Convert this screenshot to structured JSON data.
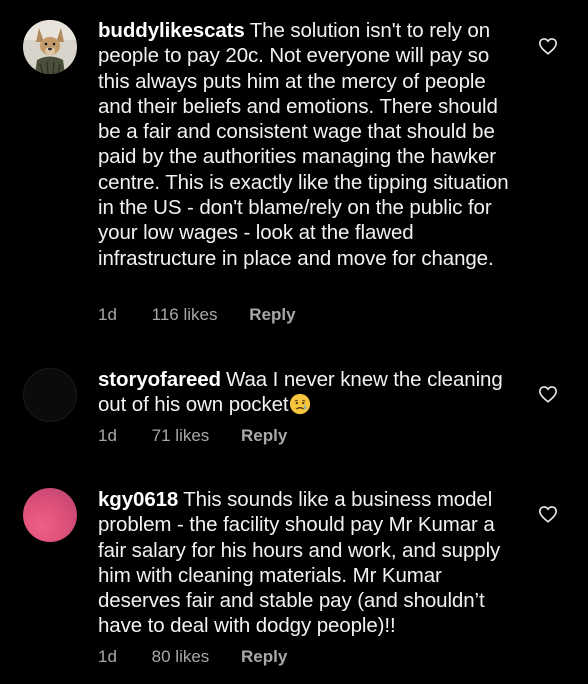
{
  "comments": [
    {
      "username": "buddylikescats",
      "text": "The solution isn't to rely on people to pay 20c. Not everyone will pay so this always puts him at the mercy of people and their beliefs and emotions. There should be a fair and consistent wage that should be paid by the authorities managing the hawker centre. This is exactly like the tipping situation in the US - don't blame/rely on the public for your low wages - look at the flawed infrastructure in place and move for change.",
      "time": "1d",
      "likes": "116 likes",
      "reply_label": "Reply",
      "avatar": "dog-photo-avatar",
      "heart_icon": "heart-outline-icon"
    },
    {
      "username": "storyofareed",
      "text": "Waa I never knew the cleaning out of his own pocket",
      "emoji": "crying-face-emoji",
      "time": "1d",
      "likes": "71 likes",
      "reply_label": "Reply",
      "avatar": "dark-avatar",
      "heart_icon": "heart-outline-icon"
    },
    {
      "username": "kgy0618",
      "text": "This sounds like a business model problem - the facility should pay Mr Kumar a fair salary for his hours and work, and supply him with cleaning materials. Mr Kumar deserves fair and stable pay (and shouldn’t have to deal with dodgy people)!!",
      "time": "1d",
      "likes": "80 likes",
      "reply_label": "Reply",
      "avatar": "pink-gradient-avatar",
      "heart_icon": "heart-outline-icon"
    }
  ],
  "colors": {
    "background": "#000000",
    "text": "#f2f2f2",
    "meta": "#a8a8a8"
  }
}
